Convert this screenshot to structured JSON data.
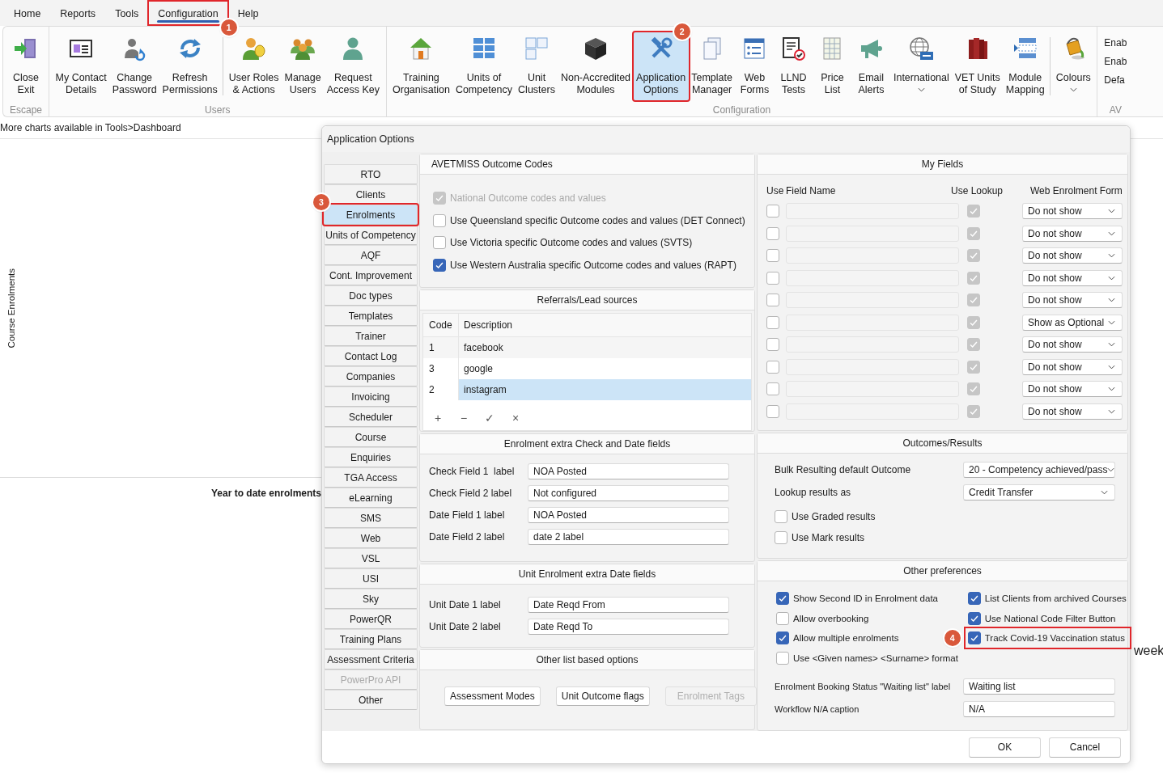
{
  "menu": [
    {
      "label": "Home",
      "selected": false
    },
    {
      "label": "Reports",
      "selected": false
    },
    {
      "label": "Tools",
      "selected": false
    },
    {
      "label": "Configuration",
      "selected": true,
      "callout": "1"
    },
    {
      "label": "Help",
      "selected": false
    }
  ],
  "ribbon": [
    {
      "kind": "buttons",
      "label": "Escape",
      "buttons": [
        {
          "lines": [
            "Close",
            "Exit"
          ],
          "selected": false
        }
      ]
    },
    {
      "kind": "buttons",
      "label": "Users",
      "buttons": [
        {
          "lines": [
            "My Contact",
            "Details"
          ],
          "selected": false
        },
        {
          "lines": [
            "Change",
            "Password"
          ],
          "selected": false
        },
        {
          "lines": [
            "Refresh",
            "Permissions"
          ],
          "selected": false
        },
        {
          "lines": [
            "User Roles",
            "& Actions"
          ],
          "selected": false,
          "separator_before": true
        },
        {
          "lines": [
            "Manage",
            "Users"
          ],
          "selected": false
        },
        {
          "lines": [
            "Request",
            "Access Key"
          ],
          "selected": false
        }
      ]
    },
    {
      "kind": "buttons",
      "label": "Configuration",
      "buttons": [
        {
          "lines": [
            "Training",
            "Organisation"
          ],
          "selected": false
        },
        {
          "lines": [
            "Units of",
            "Competency"
          ],
          "selected": false
        },
        {
          "lines": [
            "Unit",
            "Clusters"
          ],
          "selected": false
        },
        {
          "lines": [
            "Non-Accredited",
            "Modules"
          ],
          "selected": false
        },
        {
          "lines": [
            "Application",
            "Options"
          ],
          "selected": true,
          "callout": "2"
        },
        {
          "lines": [
            "Template",
            "Manager"
          ],
          "selected": false
        },
        {
          "lines": [
            "Web",
            "Forms"
          ],
          "selected": false
        },
        {
          "lines": [
            "LLND",
            "Tests"
          ],
          "selected": false
        },
        {
          "lines": [
            "Price",
            "List"
          ],
          "selected": false
        },
        {
          "lines": [
            "Email",
            "Alerts"
          ],
          "selected": false
        },
        {
          "lines": [
            "International"
          ],
          "selected": false,
          "dropdown": true
        },
        {
          "lines": [
            "VET Units",
            "of Study"
          ],
          "selected": false
        },
        {
          "lines": [
            "Module",
            "Mapping"
          ],
          "selected": false
        },
        {
          "lines": [
            "Colours"
          ],
          "selected": false,
          "dropdown": true,
          "separator_before": true
        }
      ]
    },
    {
      "kind": "list",
      "label": "AV",
      "items": [
        "Enab",
        "Enab",
        "Defa"
      ]
    }
  ],
  "dashboard": {
    "note": "More charts available in Tools>Dashboard",
    "axis_label": "Course Enrolments",
    "panel_title": "Year to date enrolments",
    "cut_text": "week"
  },
  "dialog": {
    "title": "Application Options",
    "nav": [
      {
        "label": "RTO",
        "selected": false,
        "disabled": false
      },
      {
        "label": "Clients",
        "selected": false,
        "disabled": false
      },
      {
        "label": "Enrolments",
        "selected": true,
        "disabled": false,
        "callout": "3"
      },
      {
        "label": "Units of Competency",
        "selected": false,
        "disabled": false
      },
      {
        "label": "AQF",
        "selected": false,
        "disabled": false
      },
      {
        "label": "Cont. Improvement",
        "selected": false,
        "disabled": false
      },
      {
        "label": "Doc types",
        "selected": false,
        "disabled": false
      },
      {
        "label": "Templates",
        "selected": false,
        "disabled": false
      },
      {
        "label": "Trainer",
        "selected": false,
        "disabled": false
      },
      {
        "label": "Contact Log",
        "selected": false,
        "disabled": false
      },
      {
        "label": "Companies",
        "selected": false,
        "disabled": false
      },
      {
        "label": "Invoicing",
        "selected": false,
        "disabled": false
      },
      {
        "label": "Scheduler",
        "selected": false,
        "disabled": false
      },
      {
        "label": "Course",
        "selected": false,
        "disabled": false
      },
      {
        "label": "Enquiries",
        "selected": false,
        "disabled": false
      },
      {
        "label": "TGA Access",
        "selected": false,
        "disabled": false
      },
      {
        "label": "eLearning",
        "selected": false,
        "disabled": false
      },
      {
        "label": "SMS",
        "selected": false,
        "disabled": false
      },
      {
        "label": "Web",
        "selected": false,
        "disabled": false
      },
      {
        "label": "VSL",
        "selected": false,
        "disabled": false
      },
      {
        "label": "USI",
        "selected": false,
        "disabled": false
      },
      {
        "label": "Sky",
        "selected": false,
        "disabled": false
      },
      {
        "label": "PowerQR",
        "selected": false,
        "disabled": false
      },
      {
        "label": "Training Plans",
        "selected": false,
        "disabled": false
      },
      {
        "label": "Assessment Criteria",
        "selected": false,
        "disabled": false
      },
      {
        "label": "PowerPro API",
        "selected": false,
        "disabled": true
      },
      {
        "label": "Other",
        "selected": false,
        "disabled": false
      }
    ],
    "avetmiss": {
      "title": "AVETMISS Outcome Codes",
      "options": [
        {
          "label": "National Outcome codes and values",
          "checked": true,
          "disabled": true
        },
        {
          "label": "Use Queensland specific Outcome codes and values (DET Connect)",
          "checked": false,
          "disabled": false
        },
        {
          "label": "Use Victoria specific Outcome codes and values (SVTS)",
          "checked": false,
          "disabled": false
        },
        {
          "label": "Use Western Australia specific Outcome codes and values (RAPT)",
          "checked": true,
          "disabled": false
        }
      ]
    },
    "referrals": {
      "title": "Referrals/Lead sources",
      "columns": [
        "Code",
        "Description"
      ],
      "rows": [
        {
          "code": "1",
          "description": "facebook",
          "selected": false
        },
        {
          "code": "3",
          "description": "google",
          "selected": false
        },
        {
          "code": "2",
          "description": "instagram",
          "selected": true
        }
      ],
      "tools": [
        "+",
        "−",
        "✓",
        "×"
      ]
    },
    "enrolment_fields": {
      "title": "Enrolment extra Check and Date fields",
      "fields": [
        {
          "label": "Check Field 1  label",
          "value": "NOA Posted"
        },
        {
          "label": "Check Field 2 label",
          "value": "Not configured"
        },
        {
          "label": "Date Field 1 label",
          "value": "NOA Posted"
        },
        {
          "label": "Date Field 2 label",
          "value": "date 2 label"
        }
      ]
    },
    "unit_fields": {
      "title": "Unit Enrolment extra Date fields",
      "fields": [
        {
          "label": "Unit Date 1 label",
          "value": "Date Reqd From"
        },
        {
          "label": "Unit Date 2 label",
          "value": "Date Reqd To"
        }
      ]
    },
    "list_options": {
      "title": "Other list based options",
      "buttons": [
        {
          "label": "Assessment Modes",
          "disabled": false
        },
        {
          "label": "Unit Outcome flags",
          "disabled": false
        },
        {
          "label": "Enrolment Tags",
          "disabled": true
        }
      ]
    },
    "my_fields": {
      "title": "My Fields",
      "columns": [
        "Use",
        "Field Name",
        "Use Lookup",
        "Web Enrolment Form"
      ],
      "rows": [
        {
          "use": false,
          "disabled": true,
          "lookup": true,
          "web_form": "Do not show"
        },
        {
          "use": false,
          "disabled": true,
          "lookup": true,
          "web_form": "Do not show"
        },
        {
          "use": false,
          "disabled": true,
          "lookup": true,
          "web_form": "Do not show"
        },
        {
          "use": false,
          "disabled": true,
          "lookup": true,
          "web_form": "Do not show"
        },
        {
          "use": false,
          "disabled": true,
          "lookup": true,
          "web_form": "Do not show"
        },
        {
          "use": false,
          "disabled": true,
          "lookup": true,
          "web_form": "Show as Optional"
        },
        {
          "use": false,
          "disabled": true,
          "lookup": true,
          "web_form": "Do not show"
        },
        {
          "use": false,
          "disabled": true,
          "lookup": true,
          "web_form": "Do not show"
        },
        {
          "use": false,
          "disabled": true,
          "lookup": true,
          "web_form": "Do not show"
        },
        {
          "use": false,
          "disabled": true,
          "lookup": true,
          "web_form": "Do not show"
        }
      ]
    },
    "outcomes": {
      "title": "Outcomes/Results",
      "selects": [
        {
          "label": "Bulk Resulting default Outcome",
          "value": "20 - Competency achieved/pass"
        },
        {
          "label": "Lookup results as",
          "value": "Credit Transfer"
        }
      ],
      "options": [
        {
          "label": "Use Graded results",
          "checked": false
        },
        {
          "label": "Use Mark results",
          "checked": false
        }
      ]
    },
    "preferences": {
      "title": "Other preferences",
      "left": [
        {
          "label": "Show Second ID in Enrolment data",
          "checked": true
        },
        {
          "label": "Allow overbooking",
          "checked": false
        },
        {
          "label": "Allow multiple enrolments",
          "checked": true
        },
        {
          "label": "Use <Given names> <Surname> format",
          "checked": false
        }
      ],
      "right": [
        {
          "label": "List Clients from archived Courses",
          "checked": true
        },
        {
          "label": "Use National Code Filter Button",
          "checked": true
        },
        {
          "label": "Track Covid-19 Vaccination status",
          "checked": true,
          "callout": "4"
        }
      ],
      "fields": [
        {
          "label": "Enrolment Booking Status \"Waiting list\" label",
          "value": "Waiting list"
        },
        {
          "label": "Workflow N/A caption",
          "value": "N/A"
        }
      ]
    },
    "buttons": [
      "OK",
      "Cancel"
    ]
  }
}
